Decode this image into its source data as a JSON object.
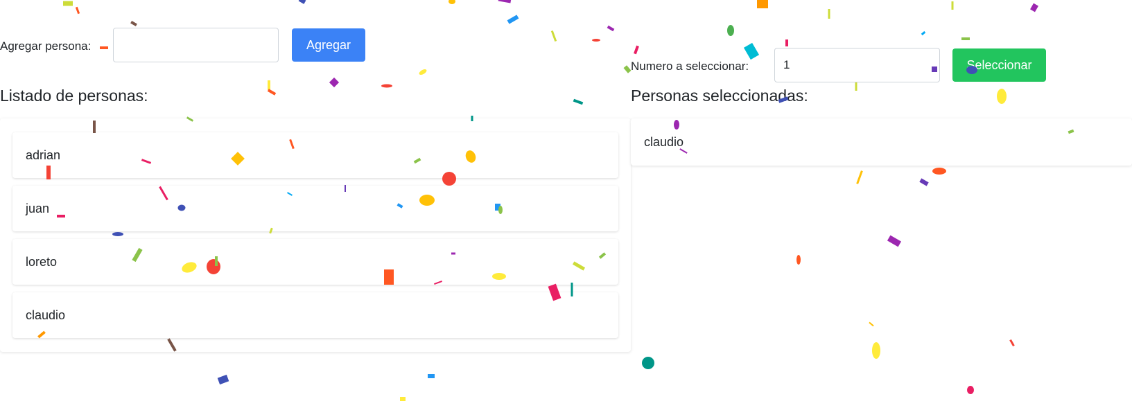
{
  "add_form": {
    "label": "Agregar persona:",
    "input_value": "",
    "button_label": "Agregar"
  },
  "select_form": {
    "label": "Numero a seleccionar:",
    "input_value": "1",
    "button_label": "Seleccionar"
  },
  "people_list": {
    "heading": "Listado de personas:",
    "items": [
      "adrian",
      "juan",
      "loreto",
      "claudio"
    ]
  },
  "selected_list": {
    "heading": "Personas seleccionadas:",
    "items": [
      "claudio"
    ]
  },
  "colors": {
    "add_button": "#3b82f6",
    "select_button": "#22c55e",
    "confetti": [
      "#f44336",
      "#e91e63",
      "#9c27b0",
      "#673ab7",
      "#3f51b5",
      "#2196f3",
      "#03a9f4",
      "#00bcd4",
      "#009688",
      "#4caf50",
      "#8bc34a",
      "#cddc39",
      "#ffeb3b",
      "#ffc107",
      "#ff9800",
      "#ff5722",
      "#795548"
    ]
  }
}
